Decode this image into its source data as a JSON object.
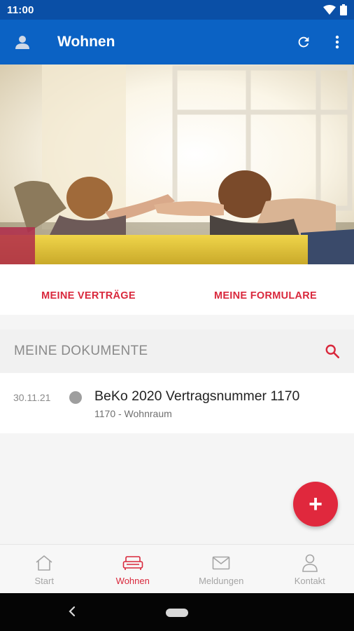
{
  "status_bar": {
    "time": "11:00"
  },
  "app_bar": {
    "title": "Wohnen"
  },
  "links": {
    "contracts": "MEINE VERTRÄGE",
    "forms": "MEINE FORMULARE"
  },
  "documents": {
    "header": "MEINE DOKUMENTE",
    "items": [
      {
        "date": "30.11.21",
        "title": "BeKo 2020 Vertragsnummer 1170",
        "subtitle": "1170 - Wohnraum"
      }
    ]
  },
  "fab": {
    "label": "+"
  },
  "bottom_nav": {
    "items": [
      {
        "label": "Start",
        "icon": "home-icon",
        "active": false
      },
      {
        "label": "Wohnen",
        "icon": "sofa-icon",
        "active": true
      },
      {
        "label": "Meldungen",
        "icon": "mail-icon",
        "active": false
      },
      {
        "label": "Kontakt",
        "icon": "person-icon",
        "active": false
      }
    ]
  },
  "colors": {
    "primary": "#0b62c4",
    "status": "#0a4fa6",
    "accent": "#d9283c",
    "fab": "#e0283d"
  }
}
